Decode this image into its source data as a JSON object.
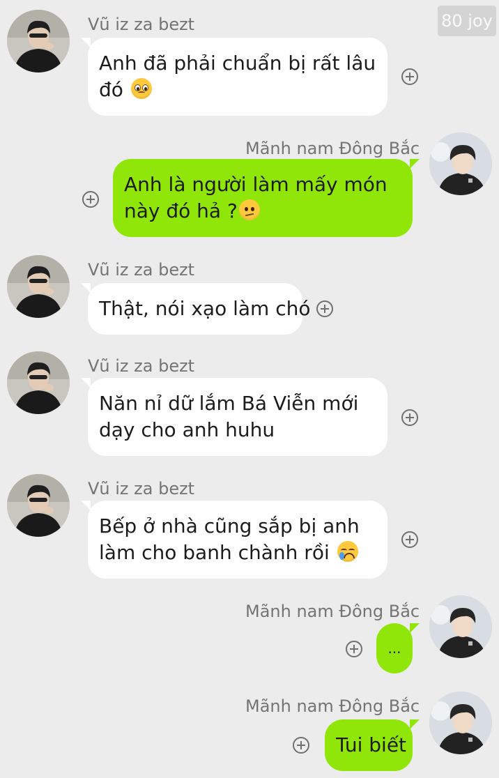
{
  "watermark": "80 joy",
  "contacts": {
    "friend": {
      "name": "Vũ iz za bezt"
    },
    "self": {
      "name": "Mãnh nam Đông Bắc"
    }
  },
  "messages": [
    {
      "sender": "Vũ iz za bezt",
      "lines": [
        "Anh đã phải chuẩn bị rất lâu",
        "đó"
      ],
      "emoji": "pleading-face-emoji"
    },
    {
      "sender": "Mãnh nam Đông Bắc",
      "lines": [
        "Anh là người làm mấy món",
        "này đó hả ?"
      ],
      "emoji": "confused-face-emoji"
    },
    {
      "sender": "Vũ iz za bezt",
      "lines": [
        "Thật, nói xạo làm chó"
      ]
    },
    {
      "sender": "Vũ iz za bezt",
      "lines": [
        "Năn nỉ dữ lắm Bá Viễn mới",
        "dạy cho anh huhu"
      ]
    },
    {
      "sender": "Vũ iz za bezt",
      "lines": [
        "Bếp ở nhà cũng sắp bị anh",
        "làm cho banh chành rồi"
      ],
      "emoji": "crying-face-emoji"
    },
    {
      "sender": "Mãnh nam Đông Bắc",
      "lines": [
        "..."
      ]
    },
    {
      "sender": "Mãnh nam Đông Bắc",
      "lines": [
        "Tui biết"
      ]
    }
  ],
  "icons": {
    "add": "plus-circle-icon",
    "avatar_friend": "user-avatar-photo",
    "avatar_self": "user-avatar-photo"
  },
  "colors": {
    "background": "#ececec",
    "incoming_bubble": "#ffffff",
    "outgoing_bubble": "#90e608",
    "name_text": "#747474"
  }
}
